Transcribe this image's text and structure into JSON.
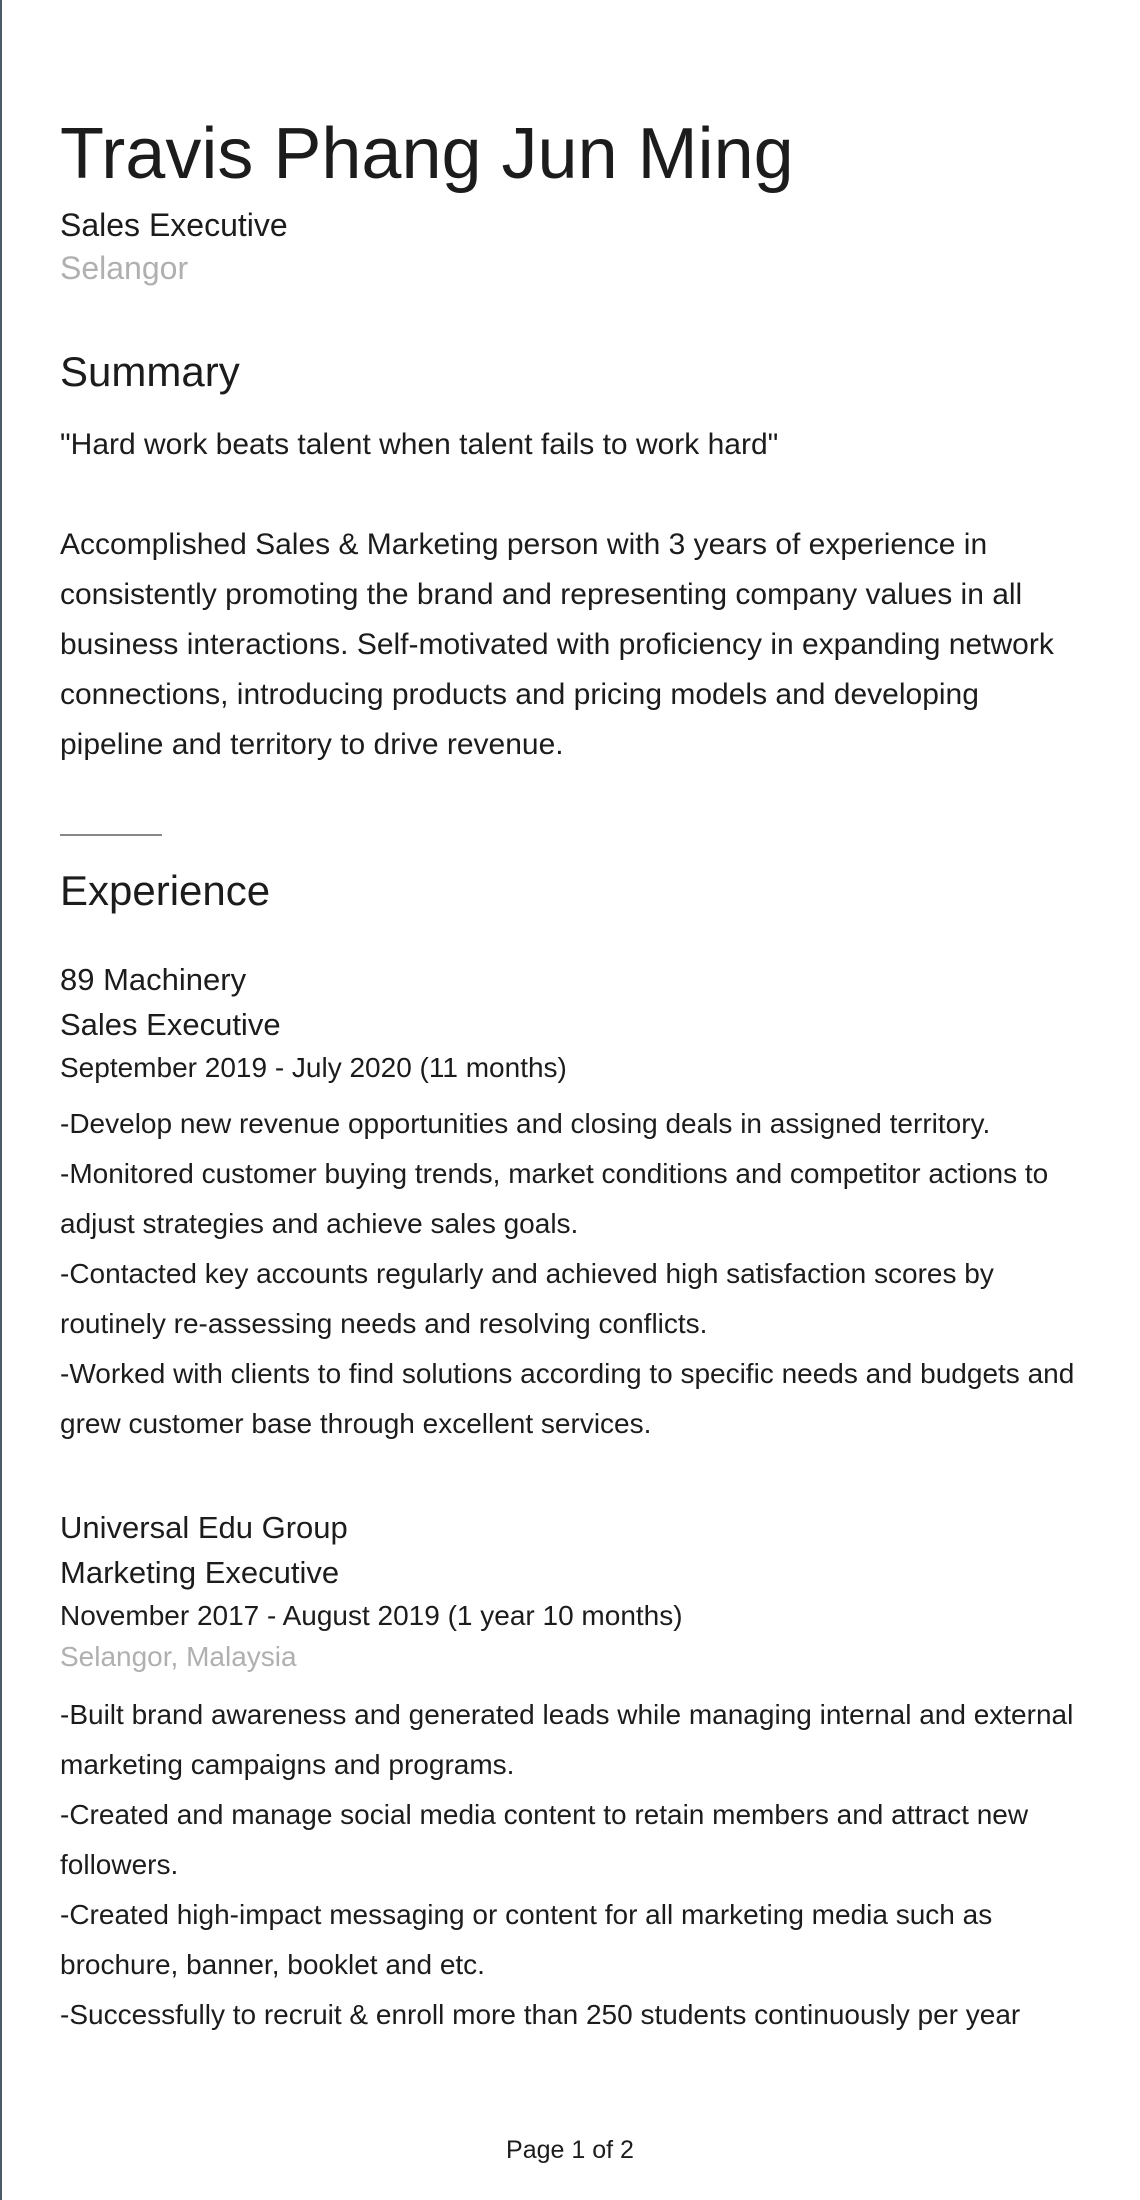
{
  "header": {
    "name": "Travis Phang Jun Ming",
    "headline": "Sales Executive",
    "location": "Selangor"
  },
  "summary": {
    "title": "Summary",
    "quote": "\"Hard work beats talent when talent fails to work hard\"",
    "text": "Accomplished Sales & Marketing person with 3 years of experience in consistently promoting the brand and representing company values in all business interactions. Self-motivated with proficiency in expanding network connections, introducing products and pricing models and developing pipeline and territory to drive revenue."
  },
  "experience": {
    "title": "Experience",
    "jobs": [
      {
        "company": "89 Machinery",
        "role": "Sales Executive",
        "dates": "September 2019 - July 2020 (11 months)",
        "location": "",
        "bullets": [
          "-Develop new revenue opportunities and closing deals in assigned territory.",
          "-Monitored customer buying trends, market conditions and competitor actions to adjust strategies and achieve sales goals.",
          "-Contacted key accounts regularly and achieved high satisfaction scores by routinely re-assessing needs and resolving conflicts.",
          "-Worked with clients to find solutions according to specific needs and budgets and grew customer base through excellent services."
        ]
      },
      {
        "company": "Universal Edu Group",
        "role": "Marketing Executive",
        "dates": "November 2017 - August 2019 (1 year 10 months)",
        "location": "Selangor, Malaysia",
        "bullets": [
          "-Built brand awareness and generated leads while managing internal and external marketing campaigns and programs.",
          "-Created and manage social media content to retain members and attract new followers.",
          "-Created high-impact messaging or content for all marketing media such as brochure, banner, booklet and etc.",
          "-Successfully to recruit & enroll more than 250 students continuously per year"
        ]
      }
    ]
  },
  "footer": {
    "page_label": "Page 1 of 2"
  }
}
